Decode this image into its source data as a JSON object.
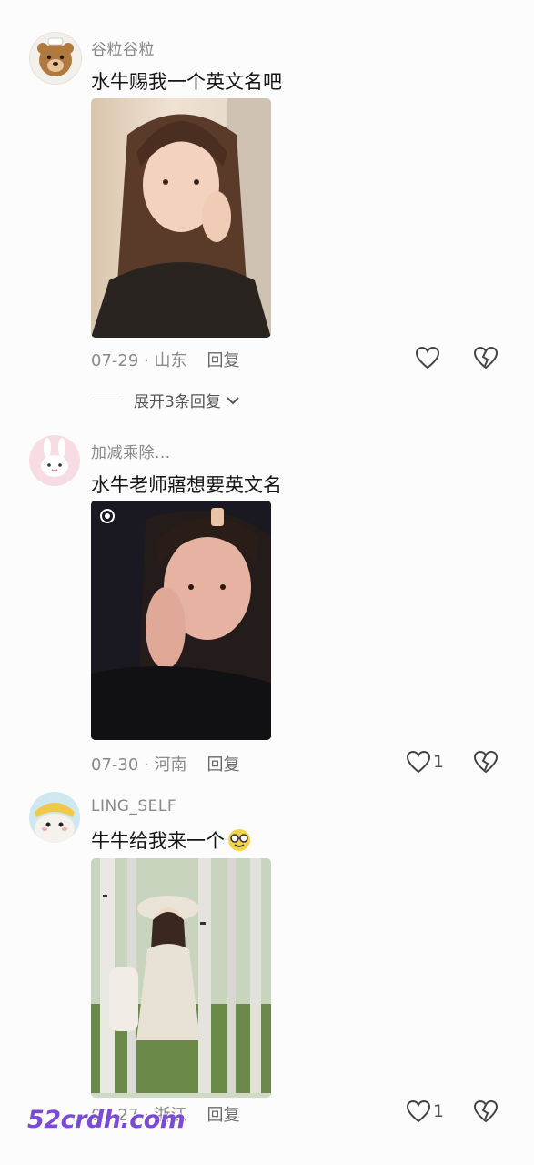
{
  "comments": [
    {
      "username": "谷粒谷粒",
      "text": "水牛赐我一个英文名吧",
      "date_location": "07-29 · 山东",
      "reply_label": "回复",
      "like_count": "",
      "expand_label": "展开3条回复"
    },
    {
      "username": "加减乘除...",
      "text": "水牛老师寤想要英文名",
      "date_location": "07-30 · 河南",
      "reply_label": "回复",
      "like_count": "1"
    },
    {
      "username": "LING_SELF",
      "text": "牛牛给我来一个",
      "date_location": "07-27 · 浙江",
      "reply_label": "回复",
      "like_count": "1"
    }
  ],
  "watermark": "52crdh.com",
  "icons": {
    "like": "heart-outline-icon",
    "dislike": "broken-heart-icon",
    "expand": "chevron-down-icon",
    "emoji": "smiling-face-with-glasses-emoji"
  }
}
